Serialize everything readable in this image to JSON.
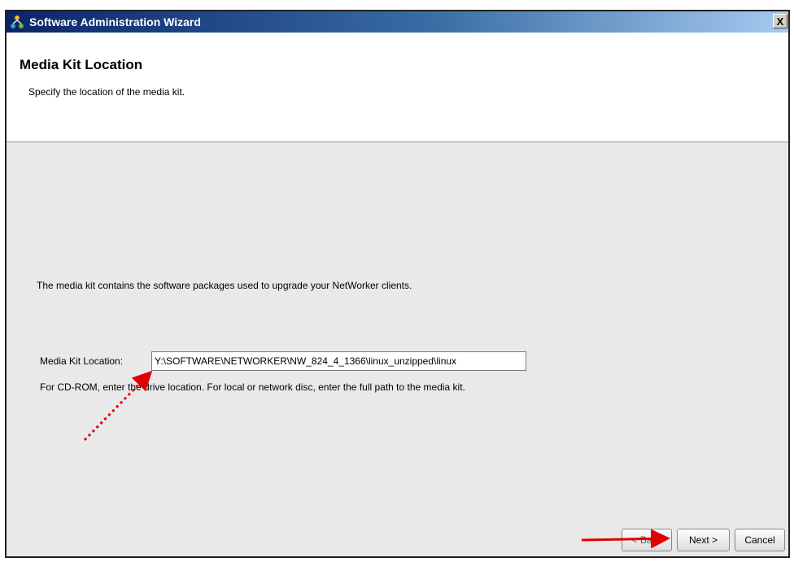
{
  "window": {
    "title": "Software Administration Wizard",
    "close_label": "X"
  },
  "header": {
    "title": "Media Kit Location",
    "subtitle": "Specify the location of the media kit."
  },
  "main": {
    "description": "The media kit contains the software packages used to upgrade your NetWorker clients.",
    "location_label": "Media Kit Location:",
    "location_value": "Y:\\SOFTWARE\\NETWORKER\\NW_824_4_1366\\linux_unzipped\\linux",
    "hint": "For CD-ROM, enter the drive location. For local or network disc, enter the full path to the media kit."
  },
  "buttons": {
    "back": "< Back",
    "next": "Next >",
    "cancel": "Cancel"
  },
  "colors": {
    "annotation_arrow": "#e00000",
    "titlebar_start": "#0a246a",
    "titlebar_end": "#a6caf0"
  },
  "icons": {
    "app": "network-nodes-icon",
    "close": "close-icon",
    "arrows": "red-annotation-arrow"
  }
}
